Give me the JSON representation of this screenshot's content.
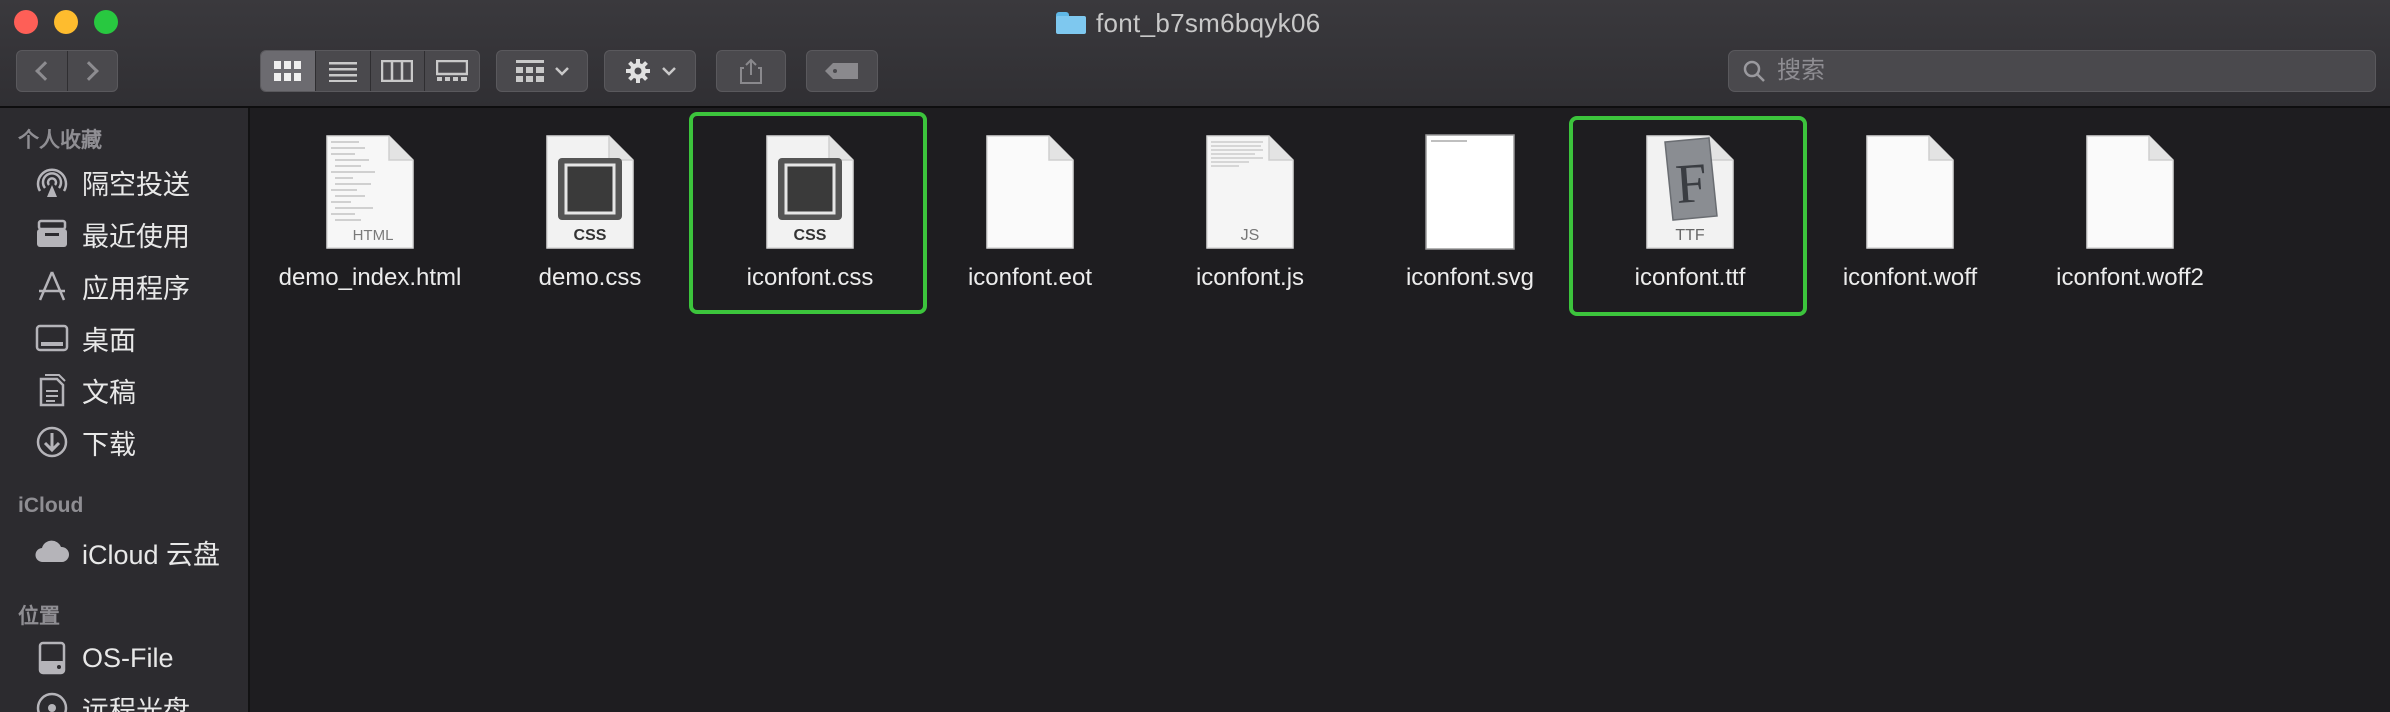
{
  "window": {
    "title": "font_b7sm6bqyk06"
  },
  "toolbar": {
    "back_icon": "chevron-left-icon",
    "forward_icon": "chevron-right-icon",
    "view_modes": [
      "icon-view",
      "list-view",
      "column-view",
      "gallery-view"
    ],
    "active_view": "icon-view",
    "search_placeholder": "搜索"
  },
  "sidebar": {
    "sections": [
      {
        "title": "个人收藏",
        "items": [
          {
            "label": "隔空投送",
            "icon": "airdrop-icon"
          },
          {
            "label": "最近使用",
            "icon": "recents-icon"
          },
          {
            "label": "应用程序",
            "icon": "applications-icon"
          },
          {
            "label": "桌面",
            "icon": "desktop-icon"
          },
          {
            "label": "文稿",
            "icon": "documents-icon"
          },
          {
            "label": "下载",
            "icon": "downloads-icon"
          }
        ]
      },
      {
        "title": "iCloud",
        "items": [
          {
            "label": "iCloud 云盘",
            "icon": "cloud-icon"
          }
        ]
      },
      {
        "title": "位置",
        "items": [
          {
            "label": "OS-File",
            "icon": "disk-icon"
          },
          {
            "label": "远程光盘",
            "icon": "remote-disc-icon"
          }
        ]
      }
    ]
  },
  "files": [
    {
      "name": "demo_index.html",
      "kind": "HTML",
      "highlighted": false
    },
    {
      "name": "demo.css",
      "kind": "CSS",
      "highlighted": false
    },
    {
      "name": "iconfont.css",
      "kind": "CSS",
      "highlighted": true
    },
    {
      "name": "iconfont.eot",
      "kind": "",
      "highlighted": false
    },
    {
      "name": "iconfont.js",
      "kind": "JS",
      "highlighted": false
    },
    {
      "name": "iconfont.svg",
      "kind": "",
      "highlighted": false
    },
    {
      "name": "iconfont.ttf",
      "kind": "TTF",
      "highlighted": true
    },
    {
      "name": "iconfont.woff",
      "kind": "",
      "highlighted": false
    },
    {
      "name": "iconfont.woff2",
      "kind": "",
      "highlighted": false
    }
  ],
  "colors": {
    "highlight": "#3cc43c",
    "sidebar_bg": "#2c2b2f",
    "content_bg": "#1e1d20"
  }
}
